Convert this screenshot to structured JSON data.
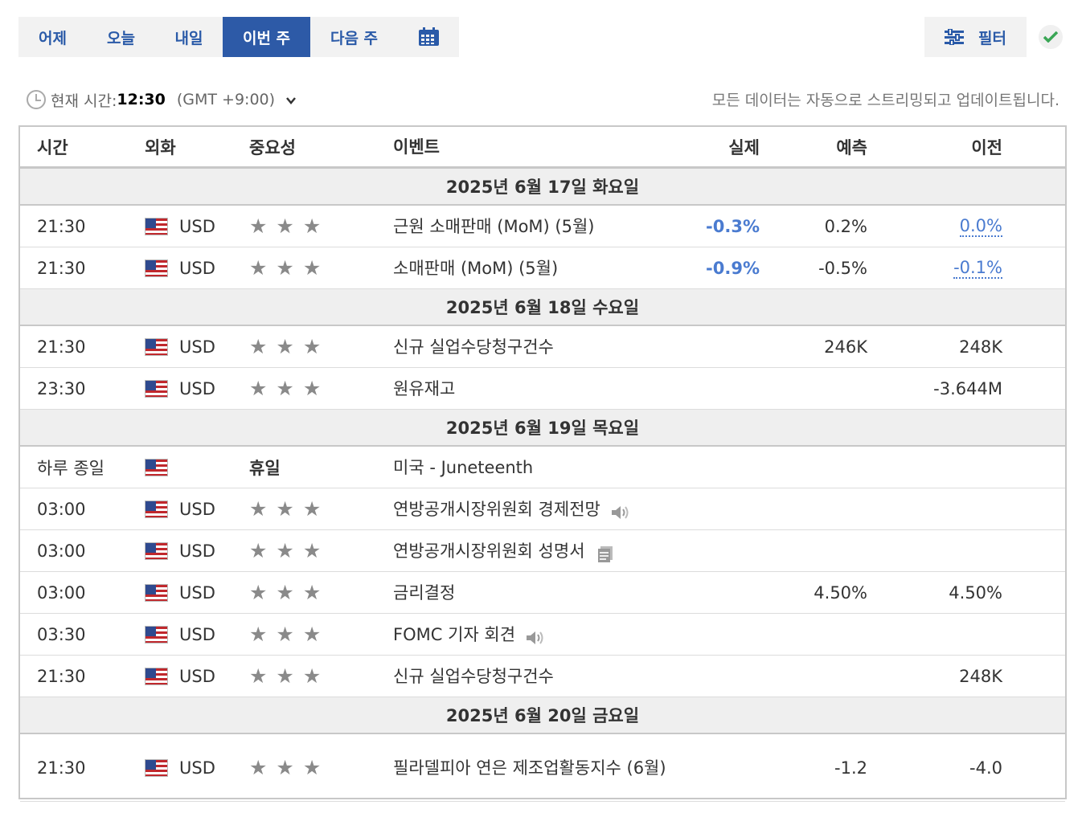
{
  "tabs": [
    {
      "label": "어제"
    },
    {
      "label": "오늘"
    },
    {
      "label": "내일"
    },
    {
      "label": "이번 주",
      "active": true
    },
    {
      "label": "다음 주"
    }
  ],
  "calendar_icon": "calendar-icon",
  "filter": {
    "label": "필터",
    "icon": "sliders-icon"
  },
  "confirm_icon": "checkmark-icon",
  "timebar": {
    "label": "현재 시간:",
    "time": "12:30",
    "timezone": "(GMT +9:00)"
  },
  "stream_note": "모든 데이터는 자동으로 스트리밍되고 업데이트됩니다.",
  "columns": {
    "time": "시간",
    "currency": "외화",
    "importance": "중요성",
    "event": "이벤트",
    "actual": "실제",
    "forecast": "예측",
    "previous": "이전"
  },
  "colors": {
    "accent": "#2d5aa7",
    "negative_value": "#4a7bd0",
    "check_green": "#3aa655"
  },
  "days": [
    {
      "date": "2025년 6월 17일 화요일",
      "events": [
        {
          "time": "21:30",
          "currency": "USD",
          "event": "근원 소매판매 (MoM) (5월)",
          "actual": "-0.3%",
          "forecast": "0.2%",
          "previous": "0.0%"
        },
        {
          "time": "21:30",
          "currency": "USD",
          "event": "소매판매 (MoM) (5월)",
          "actual": "-0.9%",
          "forecast": "-0.5%",
          "previous": "-0.1%"
        }
      ]
    },
    {
      "date": "2025년 6월 18일 수요일",
      "events": [
        {
          "time": "21:30",
          "currency": "USD",
          "event": "신규 실업수당청구건수",
          "actual": "",
          "forecast": "246K",
          "previous": "248K"
        },
        {
          "time": "23:30",
          "currency": "USD",
          "event": "원유재고",
          "actual": "",
          "forecast": "",
          "previous": "-3.644M"
        }
      ]
    },
    {
      "date": "2025년 6월 19일 목요일",
      "events": [
        {
          "time": "하루 종일",
          "currency": "",
          "importance_text": "휴일",
          "event": "미국 - Juneteenth",
          "actual": "",
          "forecast": "",
          "previous": ""
        },
        {
          "time": "03:00",
          "currency": "USD",
          "event": "연방공개시장위원회 경제전망",
          "icon": "speaker-icon",
          "actual": "",
          "forecast": "",
          "previous": ""
        },
        {
          "time": "03:00",
          "currency": "USD",
          "event": "연방공개시장위원회 성명서",
          "icon": "document-icon",
          "actual": "",
          "forecast": "",
          "previous": ""
        },
        {
          "time": "03:00",
          "currency": "USD",
          "event": "금리결정",
          "actual": "",
          "forecast": "4.50%",
          "previous": "4.50%"
        },
        {
          "time": "03:30",
          "currency": "USD",
          "event": "FOMC 기자 회견",
          "icon": "speaker-icon",
          "actual": "",
          "forecast": "",
          "previous": ""
        },
        {
          "time": "21:30",
          "currency": "USD",
          "event": "신규 실업수당청구건수",
          "actual": "",
          "forecast": "",
          "previous": "248K"
        }
      ]
    },
    {
      "date": "2025년 6월 20일 금요일",
      "events": [
        {
          "time": "21:30",
          "currency": "USD",
          "event": "필라델피아 연은 제조업활동지수 (6월)",
          "actual": "",
          "forecast": "-1.2",
          "previous": "-4.0"
        }
      ]
    }
  ]
}
